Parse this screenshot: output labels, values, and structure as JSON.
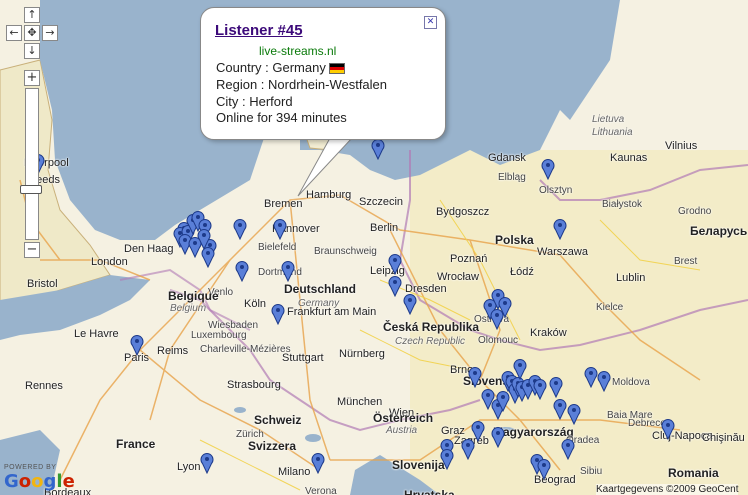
{
  "popup": {
    "title": "Listener #45",
    "site": "live-streams.nl",
    "country_line": "Country : Germany",
    "region_line": "Region : Nordrhein-Westfalen",
    "city_line": "City : Herford",
    "online_line": "Online for 394 minutes",
    "close_glyph": "✕",
    "flag_colors": [
      "#000000",
      "#dd0000",
      "#ffce00"
    ]
  },
  "nav": {
    "up": "↑",
    "left": "←",
    "center": "✥",
    "right": "→",
    "down": "↓",
    "zoom_in": "+",
    "zoom_out": "−"
  },
  "branding": {
    "powered_by": "POWERED BY",
    "google": [
      "G",
      "o",
      "o",
      "g",
      "l",
      "e"
    ],
    "copyright": "Kaartgegevens ©2009 GeoCent"
  },
  "colors": {
    "land_west": "#f7f3e4",
    "land_east": "#f3ecc8",
    "water": "#99b3cc",
    "marker": "#5a7fd8",
    "popup_title": "#3c0a7a"
  },
  "labels": [
    {
      "text": "Hamburg",
      "kind": "city"
    },
    {
      "text": "Gdansk",
      "kind": "city"
    },
    {
      "text": "Kaunas",
      "kind": "city"
    },
    {
      "text": "Vilnius",
      "kind": "city"
    },
    {
      "text": "Lietuva",
      "kind": "sub"
    },
    {
      "text": "Lithuania",
      "kind": "sub"
    },
    {
      "text": "Bremen",
      "kind": "city"
    },
    {
      "text": "Szczecin",
      "kind": "city"
    },
    {
      "text": "Elbląg",
      "kind": "small"
    },
    {
      "text": "Olsztyn",
      "kind": "small"
    },
    {
      "text": "Hannover",
      "kind": "city"
    },
    {
      "text": "Bydgoszcz",
      "kind": "city"
    },
    {
      "text": "Białystok",
      "kind": "small"
    },
    {
      "text": "Grodno",
      "kind": "small"
    },
    {
      "text": "Беларусь",
      "kind": "country"
    },
    {
      "text": "Polska",
      "kind": "country"
    },
    {
      "text": "Den Haag",
      "kind": "city"
    },
    {
      "text": "Bielefeld",
      "kind": "small"
    },
    {
      "text": "Berlin",
      "kind": "city"
    },
    {
      "text": "Poznań",
      "kind": "city"
    },
    {
      "text": "Warszawa",
      "kind": "city"
    },
    {
      "text": "Braunschweig",
      "kind": "small"
    },
    {
      "text": "Brest",
      "kind": "small"
    },
    {
      "text": "London",
      "kind": "city"
    },
    {
      "text": "Łódź",
      "kind": "city"
    },
    {
      "text": "Leipzig",
      "kind": "city"
    },
    {
      "text": "Wrocław",
      "kind": "city"
    },
    {
      "text": "Lublin",
      "kind": "city"
    },
    {
      "text": "Bristol",
      "kind": "city"
    },
    {
      "text": "Dortmund",
      "kind": "small"
    },
    {
      "text": "Deutschland",
      "kind": "country"
    },
    {
      "text": "Dresden",
      "kind": "city"
    },
    {
      "text": "Venlo",
      "kind": "small"
    },
    {
      "text": "Belgique",
      "kind": "country"
    },
    {
      "text": "Germany",
      "kind": "sub"
    },
    {
      "text": "Kielce",
      "kind": "small"
    },
    {
      "text": "Köln",
      "kind": "city"
    },
    {
      "text": "Frankfurt am Main",
      "kind": "city"
    },
    {
      "text": "Česká Republika",
      "kind": "country"
    },
    {
      "text": "Czech Republic",
      "kind": "sub"
    },
    {
      "text": "Ostrava",
      "kind": "small"
    },
    {
      "text": "Kraków",
      "kind": "city"
    },
    {
      "text": "Belgium",
      "kind": "sub"
    },
    {
      "text": "Luxembourg",
      "kind": "small"
    },
    {
      "text": "Wiesbaden",
      "kind": "small"
    },
    {
      "text": "Le Havre",
      "kind": "city"
    },
    {
      "text": "Reims",
      "kind": "city"
    },
    {
      "text": "Charleville-Mézières",
      "kind": "small"
    },
    {
      "text": "Nürnberg",
      "kind": "city"
    },
    {
      "text": "Olomouc",
      "kind": "small"
    },
    {
      "text": "Paris",
      "kind": "city"
    },
    {
      "text": "Stuttgart",
      "kind": "city"
    },
    {
      "text": "Brno",
      "kind": "city"
    },
    {
      "text": "Slovensko",
      "kind": "country"
    },
    {
      "text": "Rennes",
      "kind": "city"
    },
    {
      "text": "Strasbourg",
      "kind": "city"
    },
    {
      "text": "Wien",
      "kind": "city"
    },
    {
      "text": "München",
      "kind": "city"
    },
    {
      "text": "Österreich",
      "kind": "country"
    },
    {
      "text": "Austria",
      "kind": "sub"
    },
    {
      "text": "Schweiz",
      "kind": "country"
    },
    {
      "text": "Svizzera",
      "kind": "country"
    },
    {
      "text": "Zürich",
      "kind": "small"
    },
    {
      "text": "France",
      "kind": "country"
    },
    {
      "text": "Lyon",
      "kind": "city"
    },
    {
      "text": "Milano",
      "kind": "city"
    },
    {
      "text": "Verona",
      "kind": "small"
    },
    {
      "text": "Slovenija",
      "kind": "country"
    },
    {
      "text": "Zagreb",
      "kind": "city"
    },
    {
      "text": "Hrvatska",
      "kind": "country"
    },
    {
      "text": "Graz",
      "kind": "city"
    },
    {
      "text": "Magyarország",
      "kind": "country"
    },
    {
      "text": "Debrecen",
      "kind": "small"
    },
    {
      "text": "Oradea",
      "kind": "small"
    },
    {
      "text": "Baia Mare",
      "kind": "small"
    },
    {
      "text": "Cluj-Napoca",
      "kind": "city"
    },
    {
      "text": "Chişinău",
      "kind": "city"
    },
    {
      "text": "Romania",
      "kind": "country"
    },
    {
      "text": "Beograd",
      "kind": "city"
    },
    {
      "text": "Bordeaux",
      "kind": "city"
    },
    {
      "text": "Leeds",
      "kind": "city"
    },
    {
      "text": "Liverpool",
      "kind": "city"
    },
    {
      "text": "Moldova",
      "kind": "small"
    },
    {
      "text": "Sibiu",
      "kind": "small"
    }
  ],
  "markers": {
    "count": 57
  }
}
